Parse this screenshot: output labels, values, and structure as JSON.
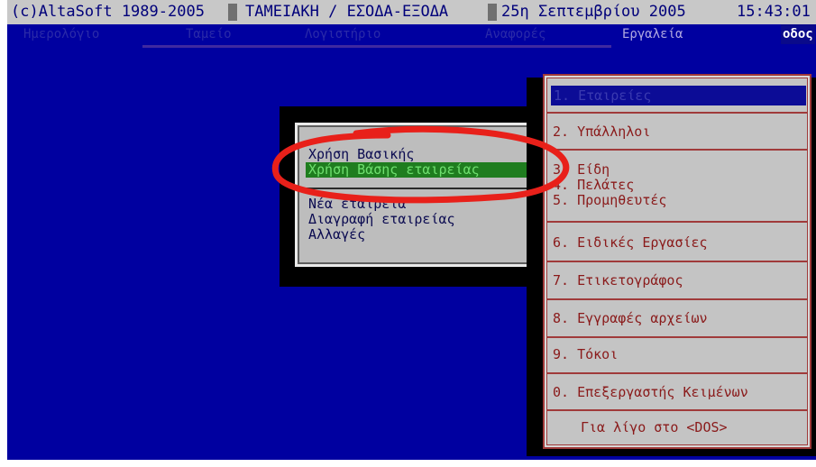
{
  "titlebar": {
    "copyright": "(c)AltaSoft 1989-2005",
    "module": "ΤΑΜΕΙΑΚΗ / ΕΣΟΔΑ-ΕΞΟΔΑ",
    "date": "25η Σεπτεμβρίου  2005",
    "time": "15:43:01"
  },
  "menubar": {
    "items": [
      "Ημερολόγιο",
      "Ταμείο",
      "Λογιστήριο",
      "Αναφορές",
      "Εργαλεία",
      "Έξοδος"
    ],
    "active": "Εργαλεία",
    "exit_visible": "οδος"
  },
  "submenu": {
    "items": [
      "Χρήση Βασικής",
      "Χρήση Βάσης εταιρείας",
      "Νέα εταιρεία",
      "Διαγραφή εταιρείας",
      "Αλλαγές"
    ],
    "highlighted_index": 1
  },
  "mainmenu": {
    "items": [
      "1. Εταιρείες",
      "2. Υπάλληλοι",
      "3. Είδη",
      "4. Πελάτες",
      "5. Προμηθευτές",
      "6. Ειδικές Εργασίες",
      "7. Ετικετογράφος",
      "8. Εγγραφές αρχείων",
      "9. Τόκοι",
      "0. Επεξεργαστής Κειμένων",
      "Για λίγο στο <DOS>"
    ],
    "highlighted_index": 0
  },
  "colors": {
    "screen_bg": "#0000a0",
    "menu_bg": "#c4c4c4",
    "menu_text": "#8a1a1a",
    "highlight_green": "#1f7d1f",
    "annotation_red": "#e8201a"
  }
}
